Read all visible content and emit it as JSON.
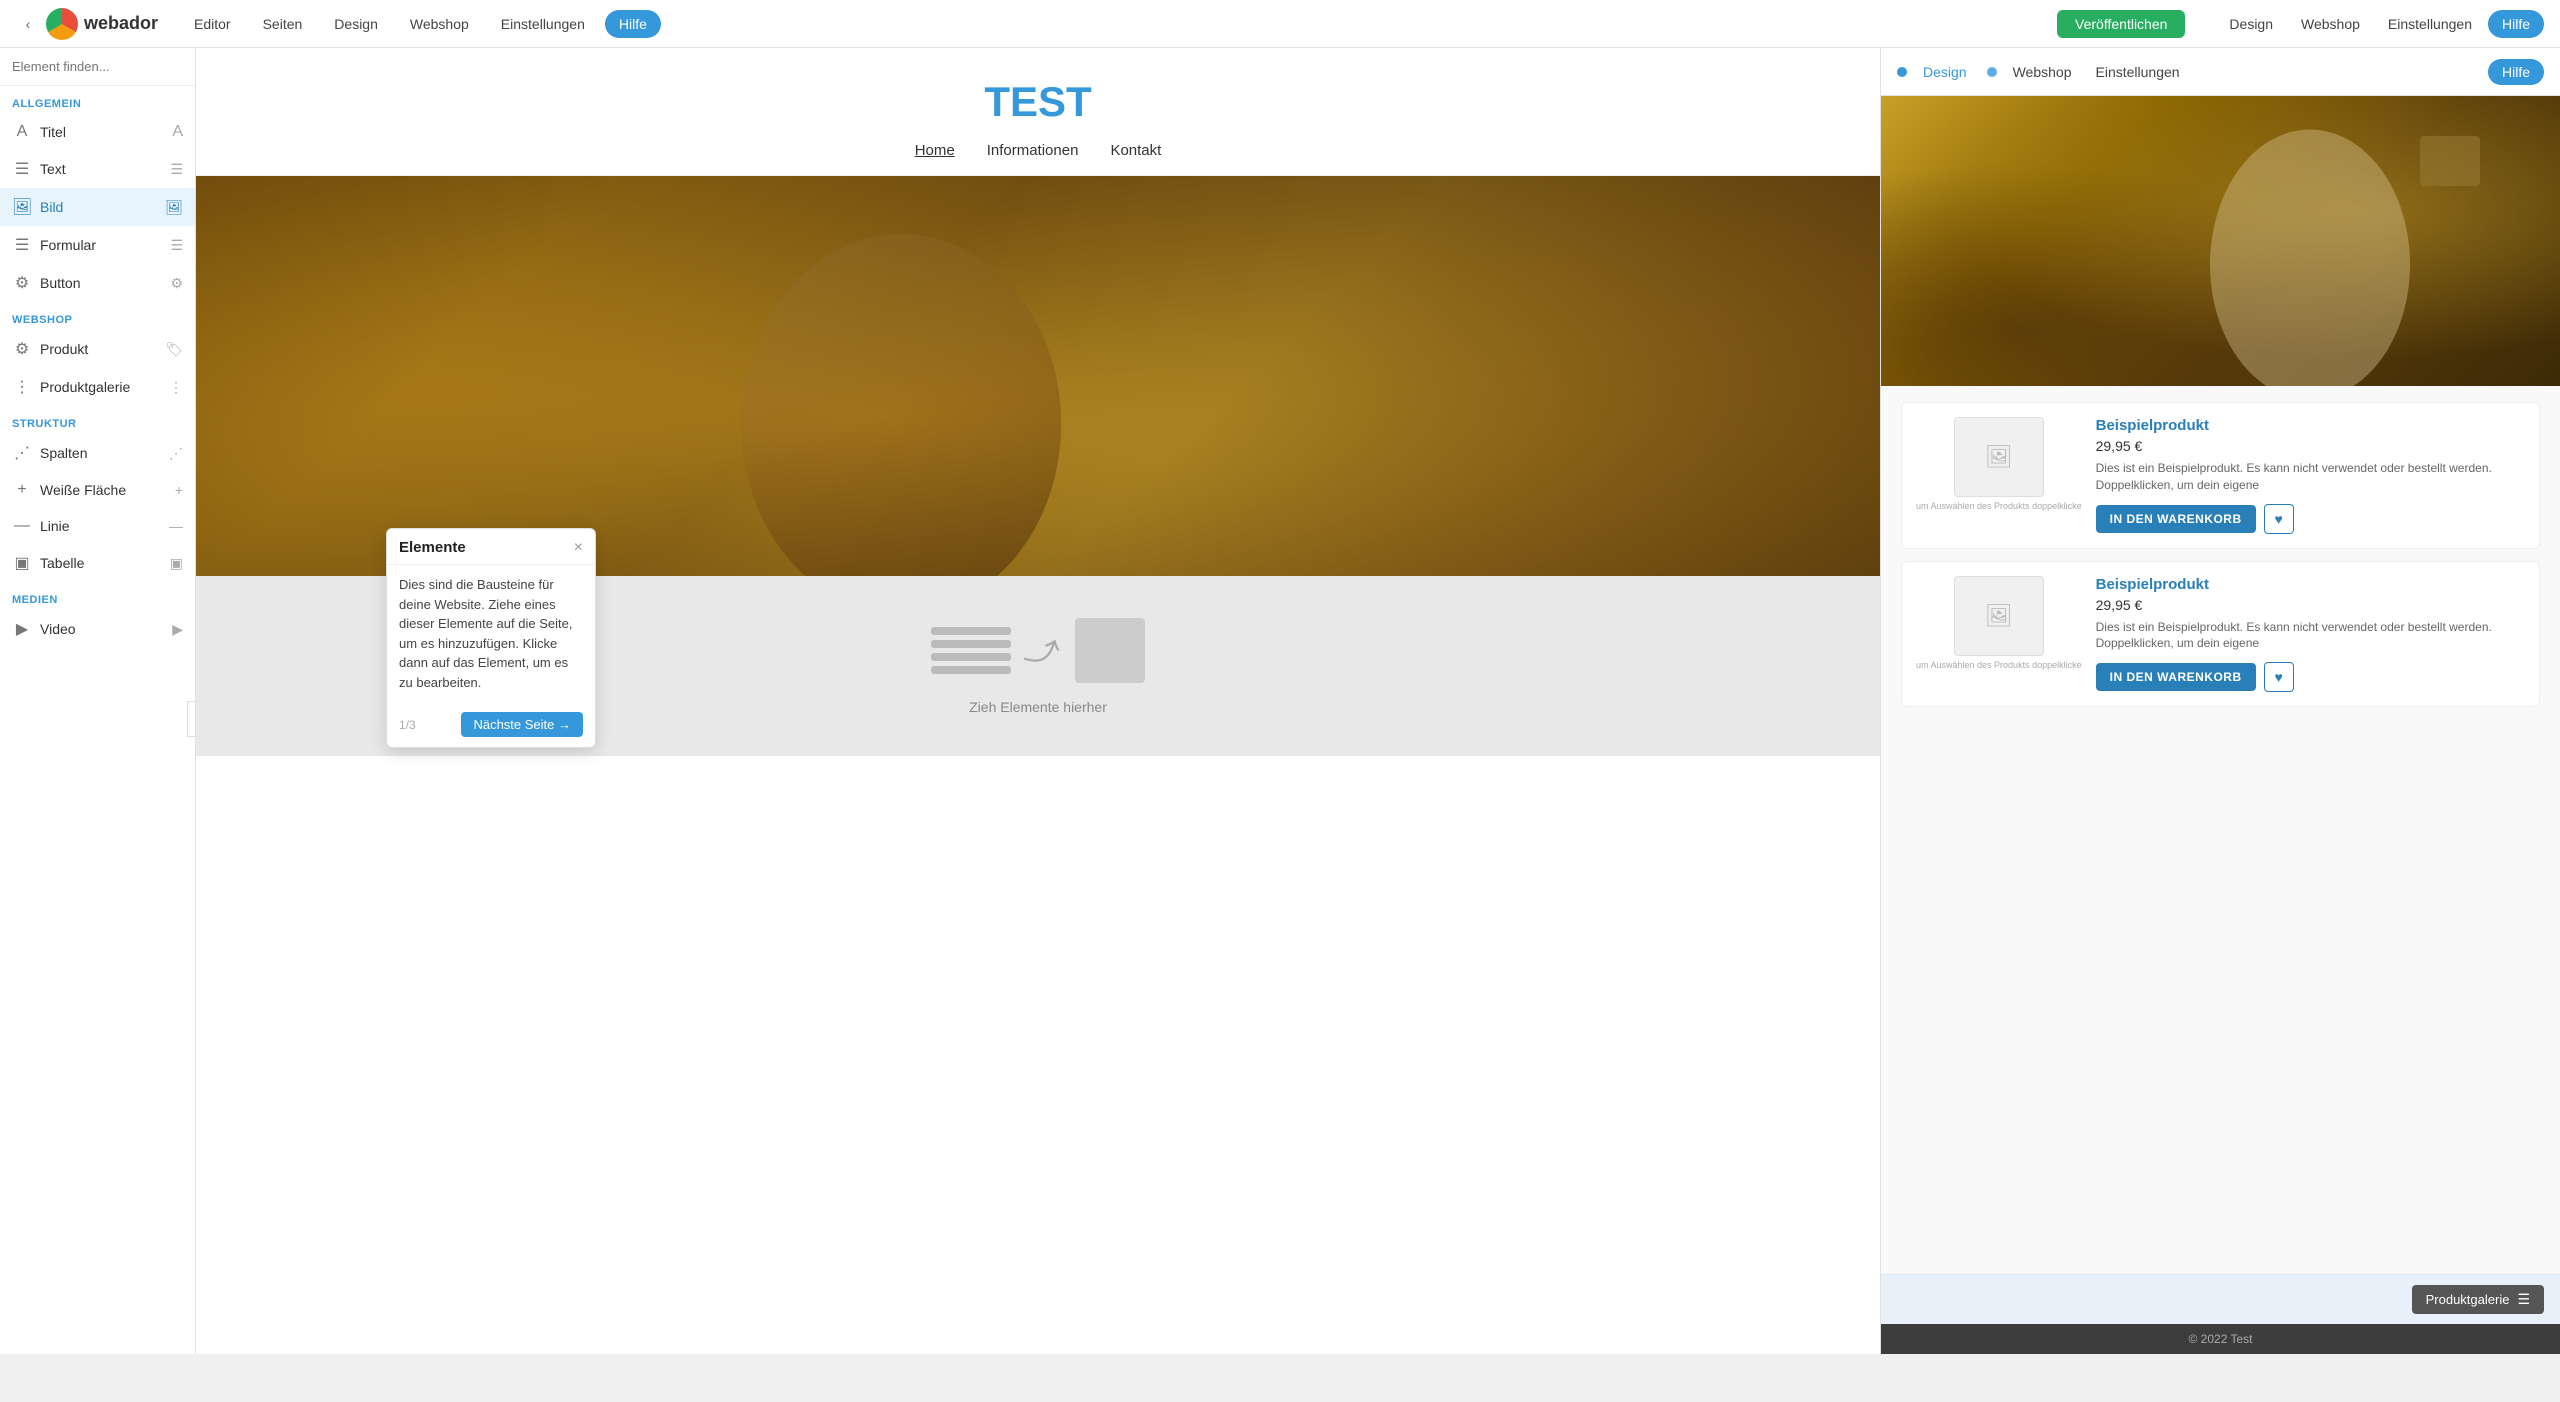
{
  "topNav": {
    "logoText": "webador",
    "links": [
      "Editor",
      "Seiten",
      "Design",
      "Webshop",
      "Einstellungen"
    ],
    "hilfeLabel": "Hilfe",
    "veroffLabel": "Veröffentlichen",
    "rightLinks": [
      "Design",
      "Webshop",
      "Einstellungen"
    ],
    "rightHilfeLabel": "Hilfe"
  },
  "sidebar": {
    "searchPlaceholder": "Element finden...",
    "sections": [
      {
        "label": "ALLGEMEIN",
        "items": [
          {
            "name": "Titel",
            "icon": "A"
          },
          {
            "name": "Text",
            "icon": "≡"
          },
          {
            "name": "Bild",
            "icon": "🖼",
            "active": true
          },
          {
            "name": "Formular",
            "icon": "≡"
          },
          {
            "name": "Button",
            "icon": "⚙"
          }
        ]
      },
      {
        "label": "WEBSHOP",
        "items": [
          {
            "name": "Produkt",
            "icon": "🏷"
          },
          {
            "name": "Produktgalerie",
            "icon": "⊞"
          }
        ]
      },
      {
        "label": "STRUKTUR",
        "items": [
          {
            "name": "Spalten",
            "icon": "⊞"
          },
          {
            "name": "Weiße Fläche",
            "icon": "+"
          },
          {
            "name": "Linie",
            "icon": "—"
          },
          {
            "name": "Tabelle",
            "icon": "⊞"
          }
        ]
      },
      {
        "label": "MEDIEN",
        "items": [
          {
            "name": "Video",
            "icon": "▶"
          }
        ]
      }
    ]
  },
  "popup": {
    "title": "Elemente",
    "closeIcon": "×",
    "body": "Dies sind die Bausteine für deine Website. Ziehe eines dieser Elemente auf die Seite, um es hinzuzufügen. Klicke dann auf das Element, um es zu bearbeiten.",
    "page": "1/3",
    "nextLabel": "Nächste Seite →"
  },
  "website": {
    "title": "TEST",
    "nav": [
      "Home",
      "Informationen",
      "Kontakt"
    ],
    "activeNav": "Home",
    "dropZoneText": "Zieh Elemente hierher"
  },
  "rightPanel": {
    "navLinks": [
      "Design",
      "Webshop",
      "Einstellungen"
    ],
    "hilfeLabel": "Hilfe",
    "dotColors": [
      "#3498db",
      "#5dade2"
    ],
    "products": [
      {
        "name": "Beispielprodukt",
        "price": "29,95 €",
        "desc": "Dies ist ein Beispielprodukt. Es kann nicht verwendet oder bestellt werden. Doppelklicken, um dein eigene",
        "imageCaption": "um Auswählen des Produkts doppelklicke",
        "cartLabel": "IN DEN WARENKORB",
        "heartIcon": "♥"
      },
      {
        "name": "Beispielprodukt",
        "price": "29,95 €",
        "desc": "Dies ist ein Beispielprodukt. Es kann nicht verwendet oder bestellt werden. Doppelklicken, um dein eigene",
        "imageCaption": "um Auswählen des Produkts doppelklicke",
        "cartLabel": "IN DEN WARENKORB",
        "heartIcon": "♥"
      }
    ],
    "galleryLabel": "Produktgalerie",
    "galleryIcon": "≡",
    "footer": "© 2022 Test"
  }
}
